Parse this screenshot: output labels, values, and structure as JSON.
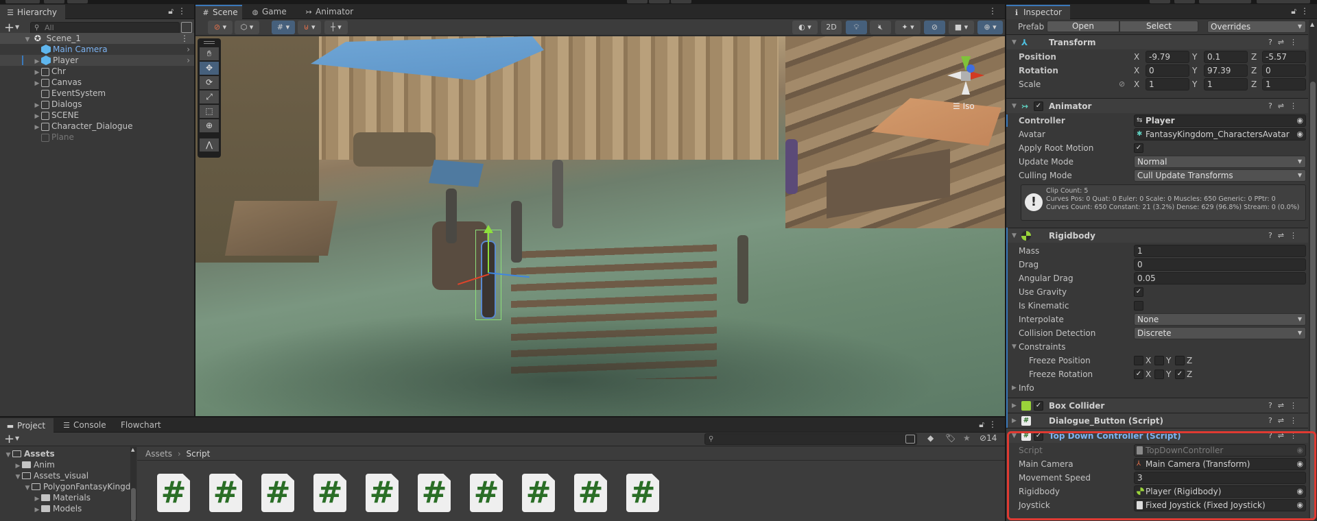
{
  "hierarchy": {
    "tab_label": "Hierarchy",
    "search_placeholder": "All",
    "scene_name": "Scene_1",
    "items": [
      {
        "label": "Main Camera",
        "expandable": false,
        "prefab": true,
        "color": "#7cb3f2"
      },
      {
        "label": "Player",
        "expandable": true,
        "prefab": true,
        "selected": true
      },
      {
        "label": "Chr",
        "expandable": true
      },
      {
        "label": "Canvas",
        "expandable": true
      },
      {
        "label": "EventSystem",
        "expandable": false
      },
      {
        "label": "Dialogs",
        "expandable": true
      },
      {
        "label": "SCENE",
        "expandable": true
      },
      {
        "label": "Character_Dialogue",
        "expandable": true
      },
      {
        "label": "Plane",
        "expandable": false,
        "disabled": true
      }
    ]
  },
  "scene_view": {
    "tabs": [
      {
        "label": "Scene",
        "icon": "#",
        "active": true
      },
      {
        "label": "Game",
        "icon": "🎮"
      },
      {
        "label": "Animator",
        "icon": "↣"
      }
    ],
    "toolbar": {
      "mode_2d": "2D"
    },
    "gizmo_label": "Iso",
    "tools": [
      "view-tool",
      "move-tool",
      "rotate-tool",
      "scale-tool",
      "rect-tool",
      "transform-tool",
      "custom-tool"
    ],
    "active_tool": "move-tool"
  },
  "inspector": {
    "tab_label": "Inspector",
    "prefab": {
      "label": "Prefab",
      "open": "Open",
      "select": "Select",
      "overrides": "Overrides"
    },
    "transform": {
      "title": "Transform",
      "position": {
        "label": "Position",
        "x": "-9.79",
        "y": "0.1",
        "z": "-5.57"
      },
      "rotation": {
        "label": "Rotation",
        "x": "0",
        "y": "97.39",
        "z": "0"
      },
      "scale": {
        "label": "Scale",
        "x": "1",
        "y": "1",
        "z": "1"
      }
    },
    "animator": {
      "title": "Animator",
      "enabled": true,
      "controller": {
        "label": "Controller",
        "value": "Player"
      },
      "avatar": {
        "label": "Avatar",
        "value": "FantasyKingdom_CharactersAvatar"
      },
      "apply_root_motion": {
        "label": "Apply Root Motion",
        "checked": true
      },
      "update_mode": {
        "label": "Update Mode",
        "value": "Normal"
      },
      "culling_mode": {
        "label": "Culling Mode",
        "value": "Cull Update Transforms"
      },
      "info": [
        "Clip Count: 5",
        "Curves Pos: 0 Quat: 0 Euler: 0 Scale: 0 Muscles: 650 Generic: 0 PPtr: 0",
        "Curves Count: 650 Constant: 21 (3.2%) Dense: 629 (96.8%) Stream: 0 (0.0%)"
      ]
    },
    "rigidbody": {
      "title": "Rigidbody",
      "mass": {
        "label": "Mass",
        "value": "1"
      },
      "drag": {
        "label": "Drag",
        "value": "0"
      },
      "angular_drag": {
        "label": "Angular Drag",
        "value": "0.05"
      },
      "use_gravity": {
        "label": "Use Gravity",
        "checked": true
      },
      "is_kinematic": {
        "label": "Is Kinematic",
        "checked": false
      },
      "interpolate": {
        "label": "Interpolate",
        "value": "None"
      },
      "collision_detection": {
        "label": "Collision Detection",
        "value": "Discrete"
      },
      "constraints": {
        "label": "Constraints"
      },
      "freeze_position": {
        "label": "Freeze Position",
        "x": false,
        "y": false,
        "z": false
      },
      "freeze_rotation": {
        "label": "Freeze Rotation",
        "x": true,
        "y": false,
        "z": true
      },
      "axis_x": "X",
      "axis_y": "Y",
      "axis_z": "Z",
      "info": {
        "label": "Info"
      }
    },
    "box_collider": {
      "title": "Box Collider",
      "enabled": true
    },
    "dialogue_button": {
      "title": "Dialogue_Button (Script)"
    },
    "top_down_controller": {
      "title": "Top Down Controller (Script)",
      "enabled": true,
      "script": {
        "label": "Script",
        "value": "TopDownController"
      },
      "main_camera": {
        "label": "Main Camera",
        "value": "Main Camera (Transform)"
      },
      "movement_speed": {
        "label": "Movement Speed",
        "value": "3"
      },
      "rigidbody": {
        "label": "Rigidbody",
        "value": "Player (Rigidbody)"
      },
      "joystick": {
        "label": "Joystick",
        "value": "Fixed Joystick (Fixed Joystick)"
      }
    }
  },
  "project": {
    "tabs": [
      {
        "label": "Project",
        "active": true
      },
      {
        "label": "Console"
      },
      {
        "label": "Flowchart"
      }
    ],
    "tree": [
      {
        "label": "Assets",
        "depth": 0,
        "open": true,
        "bold": true
      },
      {
        "label": "Anim",
        "depth": 1,
        "open": false
      },
      {
        "label": "Assets_visual",
        "depth": 1,
        "open": true
      },
      {
        "label": "PolygonFantasyKingdo",
        "depth": 2,
        "open": true
      },
      {
        "label": "Materials",
        "depth": 3,
        "open": false
      },
      {
        "label": "Models",
        "depth": 3,
        "open": false
      }
    ],
    "breadcrumb": [
      "Assets",
      "Script"
    ],
    "hidden_count": "14",
    "script_icon_glyph": "#",
    "script_count": 10
  },
  "colors": {
    "accent_blue": "#3a79bb",
    "highlight_red": "#e03a32",
    "script_green": "#2a6e26",
    "title_blue": "#7cb3f2"
  }
}
